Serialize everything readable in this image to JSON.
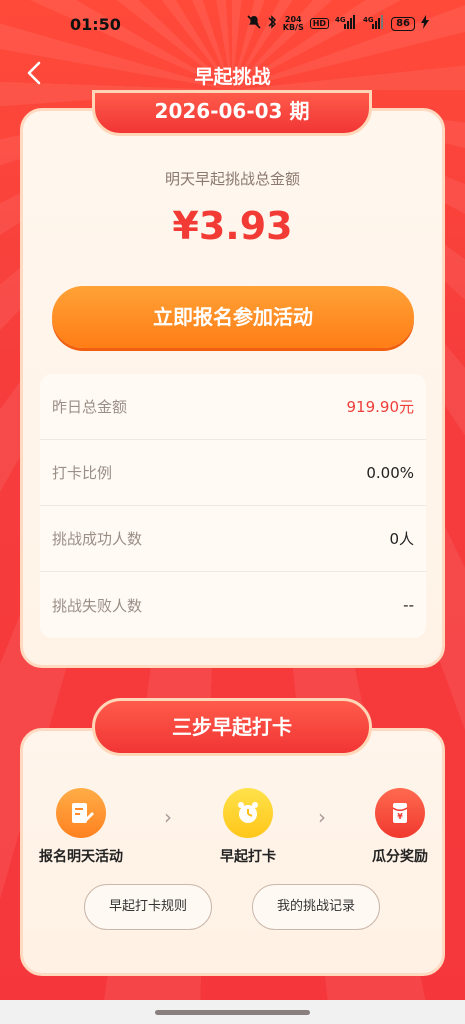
{
  "status_bar": {
    "time": "01:50",
    "net_speed": "204\nKB/S",
    "hd": "HD",
    "signal1": "4G",
    "signal2": "4G",
    "battery": "86"
  },
  "header": {
    "title": "早起挑战"
  },
  "period": {
    "label": "2026-06-03 期"
  },
  "prize": {
    "label": "明天早起挑战总金额",
    "amount": "¥3.93"
  },
  "join_button": {
    "label": "立即报名参加活动"
  },
  "stats": [
    {
      "key": "昨日总金额",
      "value": "919.90元"
    },
    {
      "key": "打卡比例",
      "value": "0.00%"
    },
    {
      "key": "挑战成功人数",
      "value": "0人"
    },
    {
      "key": "挑战失败人数",
      "value": "--"
    }
  ],
  "steps_section": {
    "title": "三步早起打卡",
    "steps": [
      {
        "label": "报名明天活动",
        "icon": "sign-up-icon"
      },
      {
        "label": "早起打卡",
        "icon": "alarm-clock-icon"
      },
      {
        "label": "瓜分奖励",
        "icon": "red-envelope-icon"
      }
    ],
    "rules_button": "早起打卡规则",
    "records_button": "我的挑战记录"
  },
  "colors": {
    "background": "#f6393a",
    "accent_red": "#f23b35",
    "button_orange": "#ff8a1f"
  }
}
